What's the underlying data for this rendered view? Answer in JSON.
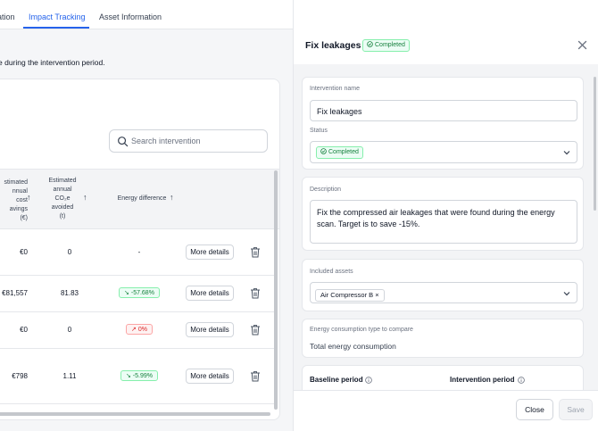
{
  "tabs": [
    {
      "label": "ation"
    },
    {
      "label": "Impact Tracking",
      "active": true
    },
    {
      "label": "Asset Information"
    }
  ],
  "intro_text": "e during the intervention period.",
  "search": {
    "placeholder": "Search intervention",
    "icon": "search-icon"
  },
  "table": {
    "headers": {
      "cost_savings": "stimated\nnnual\ncost\navings\n(€)",
      "co2_avoided": "Estimated\nannual\nCO₂e\navoided\n(t)",
      "energy_difference": "Energy difference"
    },
    "rows": [
      {
        "cost": "€0",
        "co2": "0",
        "diff": "-",
        "diff_type": "none",
        "action": "More details"
      },
      {
        "cost": "€81,557",
        "co2": "81.83",
        "diff": "↘ -57.68%",
        "diff_type": "green",
        "action": "More details"
      },
      {
        "cost": "€0",
        "co2": "0",
        "diff": "↗ 0%",
        "diff_type": "red",
        "action": "More details"
      },
      {
        "cost": "€798",
        "co2": "1.11",
        "diff": "↘ -5.99%",
        "diff_type": "green",
        "action": "More details"
      }
    ]
  },
  "drawer": {
    "title": "Fix leakages",
    "status_chip": "Completed",
    "intervention_name": {
      "label": "Intervention name",
      "value": "Fix leakages"
    },
    "status": {
      "label": "Status",
      "value": "Completed"
    },
    "description": {
      "label": "Description",
      "value": "Fix the compressed air leakages that were found during the energy scan. Target is to save -15%."
    },
    "included_assets": {
      "label": "Included assets",
      "tag": "Air Compressor B ×"
    },
    "energy_type": {
      "label": "Energy consumption type to compare",
      "value": "Total energy consumption"
    },
    "baseline_period": {
      "label": "Baseline period"
    },
    "intervention_period": {
      "label": "Intervention period"
    },
    "buttons": {
      "close": "Close",
      "save": "Save"
    }
  },
  "colors": {
    "accent": "#2563eb",
    "success": "#15803d",
    "danger": "#dc2626"
  }
}
